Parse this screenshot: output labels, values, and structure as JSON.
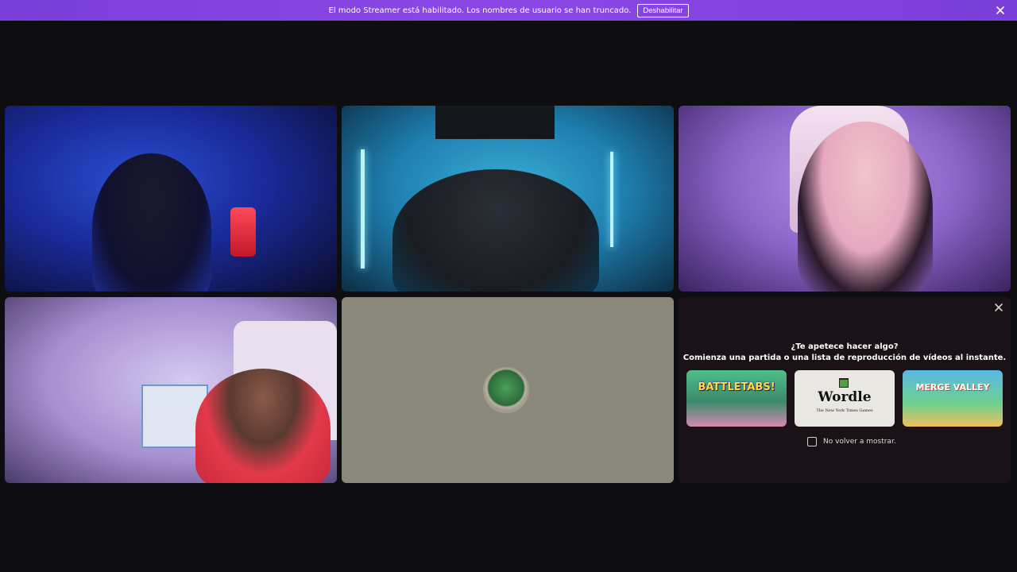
{
  "banner": {
    "message": "El modo Streamer está habilitado. Los nombres de usuario se han truncado.",
    "button_label": "Deshabilitar",
    "close_icon": "close-icon"
  },
  "tiles": [
    {
      "name": "video-tile-1"
    },
    {
      "name": "video-tile-2"
    },
    {
      "name": "video-tile-3"
    },
    {
      "name": "video-tile-4"
    },
    {
      "name": "video-tile-5-avatar"
    }
  ],
  "activity": {
    "title_line1": "¿Te apetece hacer algo?",
    "title_line2": "Comienza una partida o una lista de reproducción de vídeos al instante.",
    "cards": [
      {
        "label": "BATTLETABS!"
      },
      {
        "label": "Wordle",
        "sub": "The New York Times Games"
      },
      {
        "label": "MERGE VALLEY"
      }
    ],
    "checkbox_label": "No volver a mostrar."
  },
  "colors": {
    "banner": "#8b47e6",
    "background": "#0e0e10",
    "activity_panel": "#1a1216"
  }
}
